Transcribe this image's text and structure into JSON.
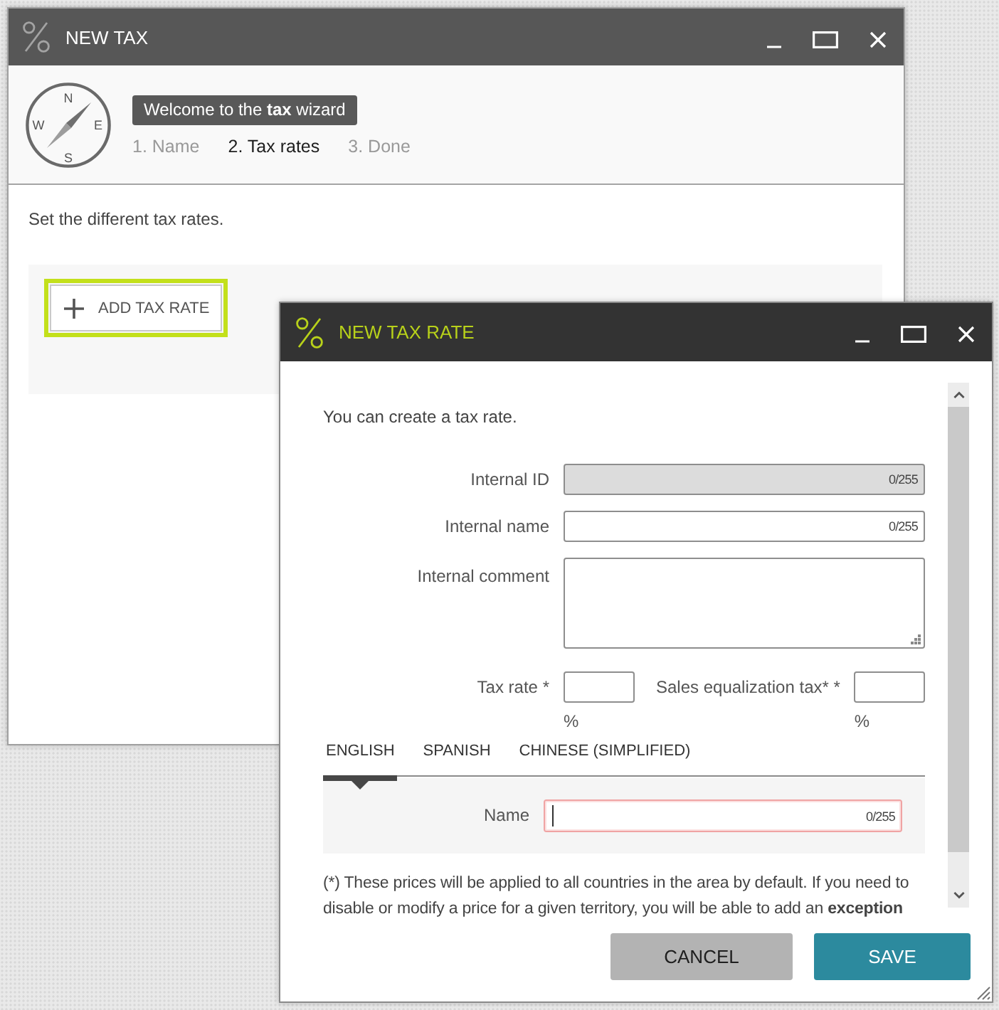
{
  "main_window": {
    "title": "NEW TAX",
    "compass_letters": [
      "N",
      "E",
      "S",
      "W"
    ],
    "banner": "Welcome to the **tax** wizard",
    "steps": [
      {
        "label": "1. Name",
        "selected": false
      },
      {
        "label": "2. Tax rates",
        "selected": true
      },
      {
        "label": "3. Done",
        "selected": false
      }
    ],
    "instructions": "Set the different tax rates.",
    "add_button": {
      "label": "ADD TAX RATE",
      "focused": true
    }
  },
  "dialog": {
    "title": "NEW TAX RATE",
    "intro": "You can create a tax rate.",
    "fields": [
      {
        "kind": "text",
        "label": "Internal ID",
        "counter": "0/255",
        "disabled": true
      },
      {
        "kind": "text",
        "label": "Internal name",
        "counter": "0/255",
        "disabled": false
      },
      {
        "kind": "textarea",
        "label": "Internal comment"
      }
    ],
    "rates": [
      {
        "label": "Tax rate *",
        "unit": "%"
      },
      {
        "label": "Sales equalization tax* *",
        "unit": "%"
      }
    ],
    "tabs": [
      {
        "label": "ENGLISH",
        "selected": true
      },
      {
        "label": "SPANISH",
        "selected": false
      },
      {
        "label": "CHINESE (SIMPLIFIED)",
        "selected": false
      }
    ],
    "name_field": {
      "label": "Name",
      "counter": "0/255",
      "focused": true,
      "invalid": true
    },
    "footnote": "(*) These prices will be applied to all countries in the area by default. If you need to disable or modify a price for a given territory, you will be able to add an **exception**",
    "buttons": [
      {
        "label": "CANCEL",
        "kind": "secondary"
      },
      {
        "label": "SAVE",
        "kind": "primary"
      }
    ]
  }
}
